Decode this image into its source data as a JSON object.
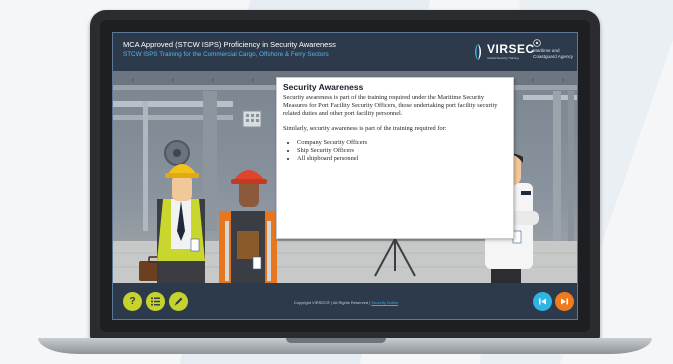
{
  "course": {
    "title": "MCA Approved (STCW ISPS) Proficiency in Security Awareness",
    "subtitle": "STCW ISPS Training for the Commercial Cargo, Offshore & Ferry Sectors"
  },
  "brand": {
    "virsec_name": "VIRSEC",
    "virsec_tagline": "Global Security Training",
    "mca_name_line1": "Maritime and",
    "mca_name_line2": "Coastguard Agency"
  },
  "slide": {
    "heading": "Security Awareness",
    "paragraph1": "Security awareness is part of the training required under the Maritime Security Measures for Port Facility Security Officers, those undertaking port facility security related duties and other port facility personnel.",
    "paragraph2": "Similarly, security awareness is part of the training required for:",
    "bullets": [
      "Company Security Officers",
      "Ship Security Officers",
      "All shipboard personnel"
    ]
  },
  "footer": {
    "copyright": "Copyright VIRSEC® | All Rights Reserved |",
    "link_label": "Security Notice",
    "help_label": "?",
    "prev_label": "|<",
    "next_label": ">|"
  },
  "icons": {
    "help": "question-icon",
    "menu": "list-icon",
    "notes": "pencil-icon",
    "prev": "skip-back-icon",
    "next": "skip-forward-icon"
  },
  "colors": {
    "header_bg": "#2d3a4c",
    "accent_blue": "#56b6e5",
    "accent_lime": "#c7d32d",
    "accent_orange": "#f07b1c",
    "prev_blue": "#2fb4e4"
  }
}
